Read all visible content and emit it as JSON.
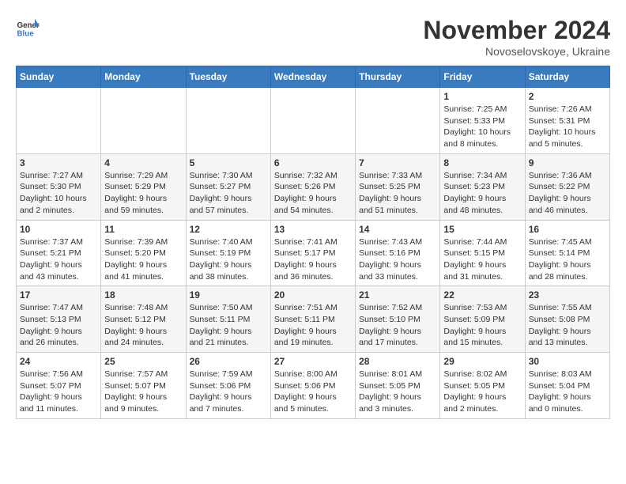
{
  "header": {
    "logo_line1": "General",
    "logo_line2": "Blue",
    "month": "November 2024",
    "location": "Novoselovskoye, Ukraine"
  },
  "weekdays": [
    "Sunday",
    "Monday",
    "Tuesday",
    "Wednesday",
    "Thursday",
    "Friday",
    "Saturday"
  ],
  "weeks": [
    [
      {
        "day": "",
        "info": ""
      },
      {
        "day": "",
        "info": ""
      },
      {
        "day": "",
        "info": ""
      },
      {
        "day": "",
        "info": ""
      },
      {
        "day": "",
        "info": ""
      },
      {
        "day": "1",
        "info": "Sunrise: 7:25 AM\nSunset: 5:33 PM\nDaylight: 10 hours\nand 8 minutes."
      },
      {
        "day": "2",
        "info": "Sunrise: 7:26 AM\nSunset: 5:31 PM\nDaylight: 10 hours\nand 5 minutes."
      }
    ],
    [
      {
        "day": "3",
        "info": "Sunrise: 7:27 AM\nSunset: 5:30 PM\nDaylight: 10 hours\nand 2 minutes."
      },
      {
        "day": "4",
        "info": "Sunrise: 7:29 AM\nSunset: 5:29 PM\nDaylight: 9 hours\nand 59 minutes."
      },
      {
        "day": "5",
        "info": "Sunrise: 7:30 AM\nSunset: 5:27 PM\nDaylight: 9 hours\nand 57 minutes."
      },
      {
        "day": "6",
        "info": "Sunrise: 7:32 AM\nSunset: 5:26 PM\nDaylight: 9 hours\nand 54 minutes."
      },
      {
        "day": "7",
        "info": "Sunrise: 7:33 AM\nSunset: 5:25 PM\nDaylight: 9 hours\nand 51 minutes."
      },
      {
        "day": "8",
        "info": "Sunrise: 7:34 AM\nSunset: 5:23 PM\nDaylight: 9 hours\nand 48 minutes."
      },
      {
        "day": "9",
        "info": "Sunrise: 7:36 AM\nSunset: 5:22 PM\nDaylight: 9 hours\nand 46 minutes."
      }
    ],
    [
      {
        "day": "10",
        "info": "Sunrise: 7:37 AM\nSunset: 5:21 PM\nDaylight: 9 hours\nand 43 minutes."
      },
      {
        "day": "11",
        "info": "Sunrise: 7:39 AM\nSunset: 5:20 PM\nDaylight: 9 hours\nand 41 minutes."
      },
      {
        "day": "12",
        "info": "Sunrise: 7:40 AM\nSunset: 5:19 PM\nDaylight: 9 hours\nand 38 minutes."
      },
      {
        "day": "13",
        "info": "Sunrise: 7:41 AM\nSunset: 5:17 PM\nDaylight: 9 hours\nand 36 minutes."
      },
      {
        "day": "14",
        "info": "Sunrise: 7:43 AM\nSunset: 5:16 PM\nDaylight: 9 hours\nand 33 minutes."
      },
      {
        "day": "15",
        "info": "Sunrise: 7:44 AM\nSunset: 5:15 PM\nDaylight: 9 hours\nand 31 minutes."
      },
      {
        "day": "16",
        "info": "Sunrise: 7:45 AM\nSunset: 5:14 PM\nDaylight: 9 hours\nand 28 minutes."
      }
    ],
    [
      {
        "day": "17",
        "info": "Sunrise: 7:47 AM\nSunset: 5:13 PM\nDaylight: 9 hours\nand 26 minutes."
      },
      {
        "day": "18",
        "info": "Sunrise: 7:48 AM\nSunset: 5:12 PM\nDaylight: 9 hours\nand 24 minutes."
      },
      {
        "day": "19",
        "info": "Sunrise: 7:50 AM\nSunset: 5:11 PM\nDaylight: 9 hours\nand 21 minutes."
      },
      {
        "day": "20",
        "info": "Sunrise: 7:51 AM\nSunset: 5:11 PM\nDaylight: 9 hours\nand 19 minutes."
      },
      {
        "day": "21",
        "info": "Sunrise: 7:52 AM\nSunset: 5:10 PM\nDaylight: 9 hours\nand 17 minutes."
      },
      {
        "day": "22",
        "info": "Sunrise: 7:53 AM\nSunset: 5:09 PM\nDaylight: 9 hours\nand 15 minutes."
      },
      {
        "day": "23",
        "info": "Sunrise: 7:55 AM\nSunset: 5:08 PM\nDaylight: 9 hours\nand 13 minutes."
      }
    ],
    [
      {
        "day": "24",
        "info": "Sunrise: 7:56 AM\nSunset: 5:07 PM\nDaylight: 9 hours\nand 11 minutes."
      },
      {
        "day": "25",
        "info": "Sunrise: 7:57 AM\nSunset: 5:07 PM\nDaylight: 9 hours\nand 9 minutes."
      },
      {
        "day": "26",
        "info": "Sunrise: 7:59 AM\nSunset: 5:06 PM\nDaylight: 9 hours\nand 7 minutes."
      },
      {
        "day": "27",
        "info": "Sunrise: 8:00 AM\nSunset: 5:06 PM\nDaylight: 9 hours\nand 5 minutes."
      },
      {
        "day": "28",
        "info": "Sunrise: 8:01 AM\nSunset: 5:05 PM\nDaylight: 9 hours\nand 3 minutes."
      },
      {
        "day": "29",
        "info": "Sunrise: 8:02 AM\nSunset: 5:05 PM\nDaylight: 9 hours\nand 2 minutes."
      },
      {
        "day": "30",
        "info": "Sunrise: 8:03 AM\nSunset: 5:04 PM\nDaylight: 9 hours\nand 0 minutes."
      }
    ]
  ]
}
